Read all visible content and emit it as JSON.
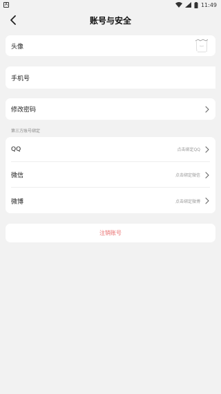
{
  "status_bar": {
    "time": "11:49",
    "left_indicator": "A"
  },
  "header": {
    "title": "账号与安全"
  },
  "avatar_row": {
    "label": "头像"
  },
  "phone_row": {
    "label": "手机号"
  },
  "password_row": {
    "label": "修改密码"
  },
  "third_party": {
    "section_label": "第三方账号绑定",
    "items": [
      {
        "label": "QQ",
        "hint": "点击绑定QQ"
      },
      {
        "label": "微信",
        "hint": "点击绑定微信"
      },
      {
        "label": "微博",
        "hint": "点击绑定微博"
      }
    ]
  },
  "delete_account": {
    "label": "注销账号"
  },
  "colors": {
    "accent_red": "#e86b6b",
    "background": "#f2f2f2",
    "card": "#ffffff"
  }
}
